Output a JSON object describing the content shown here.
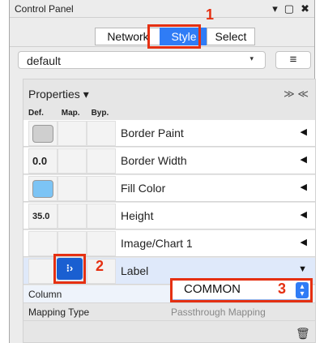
{
  "window": {
    "title": "Control Panel",
    "controls": [
      "▾",
      "▢",
      "✖"
    ]
  },
  "tabs": [
    {
      "label": "Network"
    },
    {
      "label": "Style"
    },
    {
      "label": "Select"
    }
  ],
  "style_select": {
    "value": "default",
    "arrow": "▾"
  },
  "menu_button": {
    "label": "≡"
  },
  "properties": {
    "header": "Properties ▾",
    "collapse_icons": "≫ ≪",
    "columns": [
      "Def.",
      "Map.",
      "Byp."
    ],
    "rows": [
      {
        "name": "Border Paint",
        "def_kind": "swatch",
        "def_color": "#cfcfcf",
        "expand": "◀"
      },
      {
        "name": "Border Width",
        "def_kind": "number",
        "def_text": "0.0",
        "expand": "◀"
      },
      {
        "name": "Fill Color",
        "def_kind": "swatch",
        "def_color": "#7cc4f5",
        "expand": "◀"
      },
      {
        "name": "Height",
        "def_kind": "number",
        "def_text": "35.0",
        "expand": "◀"
      },
      {
        "name": "Image/Chart 1",
        "def_kind": "empty",
        "expand": "◀"
      },
      {
        "name": "Label",
        "def_kind": "empty",
        "expand": "▼"
      }
    ],
    "mapping_button": "⁝›",
    "column_label": "Column",
    "column_value": "COMMON",
    "mapping_type_label": "Mapping Type",
    "mapping_type_value": "Passthrough Mapping"
  },
  "callouts": [
    "1",
    "2",
    "3"
  ],
  "colors": {
    "accent": "#2f7cf6",
    "callout": "#e53012",
    "mapping_button": "#1a5fd1"
  }
}
